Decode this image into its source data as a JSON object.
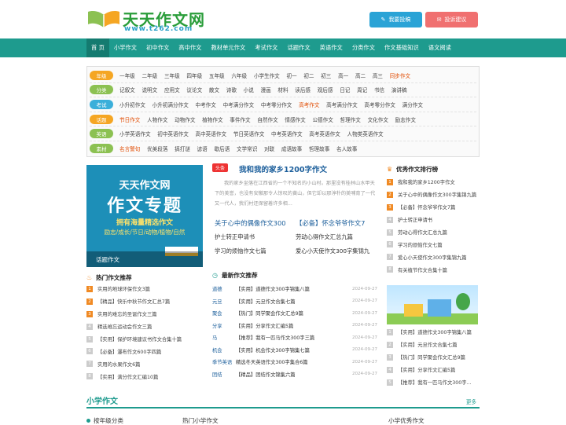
{
  "header": {
    "logo_text": "天天作文网",
    "logo_url": "www.t262.com",
    "submit_label": "我要投稿",
    "suggest_label": "投诉建议"
  },
  "nav": [
    "首 页",
    "小学作文",
    "初中作文",
    "高中作文",
    "教材单元作文",
    "考试作文",
    "话题作文",
    "英语作文",
    "分类作文",
    "作文基础知识",
    "语文阅读"
  ],
  "categories": [
    {
      "tag": "年级",
      "color": "#f5a623",
      "items": [
        "一年级",
        "二年级",
        "三年级",
        "四年级",
        "五年级",
        "六年级",
        "小学生作文",
        "初一",
        "初二",
        "初三",
        "高一",
        "高二",
        "高三"
      ],
      "extra": "同步作文"
    },
    {
      "tag": "分类",
      "color": "#8cc152",
      "items": [
        "记叙文",
        "说明文",
        "应用文",
        "议论文",
        "散文",
        "诗歌",
        "小说",
        "漫画",
        "材料",
        "读后感",
        "观后感",
        "日记",
        "周记",
        "书信",
        "演讲稿"
      ],
      "extra": ""
    },
    {
      "tag": "考试",
      "color": "#3bafda",
      "items": [
        "小升初作文",
        "小升初满分作文",
        "中考作文",
        "中考满分作文",
        "中考零分作文",
        "高考作文",
        "高考满分作文",
        "高考零分作文",
        "满分作文"
      ],
      "extra": ""
    },
    {
      "tag": "话题",
      "color": "#f5a623",
      "items": [
        "节日作文",
        "人物作文",
        "动物作文",
        "植物作文",
        "事件作文",
        "自然作文",
        "情感作文",
        "公德作文",
        "哲理作文",
        "文化作文",
        "励志作文"
      ],
      "extra": ""
    },
    {
      "tag": "英语",
      "color": "#8cc152",
      "items": [
        "小学英语作文",
        "初中英语作文",
        "高中英语作文",
        "节日英语作文",
        "中考英语作文",
        "高考英语作文",
        "人物类英语作文"
      ],
      "extra": ""
    },
    {
      "tag": "素材",
      "color": "#8cc152",
      "items": [
        "名言警句",
        "优美段落",
        "搞打谜",
        "谚语",
        "歇后语",
        "文学常识",
        "对联",
        "成语故事",
        "哲理故事",
        "名人故事"
      ],
      "extra": ""
    }
  ],
  "banner": {
    "line1": "天天作文网",
    "line2": "作文专题",
    "line3": "拥有海量精选作文",
    "line4": "励志/成长/节日/动物/植物/自然",
    "caption": "话题作文"
  },
  "hot": {
    "title": "热门作文推荐",
    "items": [
      "实用的地球环保作文3篇",
      "【精品】快乐中秋节作文汇总7篇",
      "实用的难忘的圣诞作文三篇",
      "精选难忘运动会作文三篇",
      "【实用】保护环境建议书作文合集十篇",
      "【必备】瀑布作文600字四篇",
      "实用的水果作文6篇",
      "【实用】满分作文汇编10篇"
    ]
  },
  "featured": {
    "badge": "头条",
    "title": "我和我的家乡1200字作文",
    "summary": "我的家乡坐落在江西省的一个不知名的小山村。那里没有桂林山水甲天下的美誉，也没有安徽那令人惊叹的黄山，但它却以那淳朴的美哺育了一代又一代人，我们村还保留着许多相…",
    "picks": [
      "关于心中的偶像作文300",
      "【必备】怀念爷爷作文7"
    ],
    "links": [
      "护士转正申请书",
      "劳动心得作文汇总九篇",
      "学习的烦恼作文七篇",
      "爱心小天使作文300字集锦九"
    ]
  },
  "latest": {
    "title": "最新作文推荐",
    "rows": [
      {
        "cat": "道德",
        "title": "【实用】道德作文300字锦集八篇",
        "date": "2024-09-27"
      },
      {
        "cat": "元旦",
        "title": "【实用】元旦作文合集七篇",
        "date": "2024-09-27"
      },
      {
        "cat": "聚会",
        "title": "【热门】同学聚会作文汇总9篇",
        "date": "2024-09-27"
      },
      {
        "cat": "分享",
        "title": "【实用】分享作文汇编5篇",
        "date": "2024-09-27"
      },
      {
        "cat": "马",
        "title": "【推荐】我有一匹马作文300字三篇",
        "date": "2024-09-27"
      },
      {
        "cat": "机会",
        "title": "【实用】机会作文300字锦集七篇",
        "date": "2024-09-27"
      },
      {
        "cat": "季节英语",
        "title": "精选冬天英语作文300字集合6篇",
        "date": "2024-09-27"
      },
      {
        "cat": "团结",
        "title": "【精品】团结作文锦集六篇",
        "date": "2024-09-27"
      }
    ]
  },
  "rank": {
    "title": "优秀作文排行榜",
    "items": [
      "我和我的家乡1200字作文",
      "关于心中的偶像作文300字集锦九篇",
      "【必备】怀念爷爷作文7篇",
      "护士转正申请书",
      "劳动心得作文汇总九篇",
      "学习的烦恼作文七篇",
      "爱心小天使作文300字集锦九篇",
      "有关植节作文合集十篇"
    ],
    "items2": [
      "【实用】道德作文300字锦集八篇",
      "【实用】元旦作文合集七篇",
      "【热门】同学聚会作文汇总9篇",
      "【实用】分享作文汇编5篇",
      "【推荐】我有一匹马作文300字..."
    ]
  },
  "section": {
    "title": "小学作文",
    "more": "更多",
    "sub1": "按年级分类",
    "sub2": "热门小学作文",
    "sub3": "小学优秀作文"
  },
  "colors": {
    "brand": "#1e9b8e",
    "accent": "#f08a24",
    "link": "#1b5e9b"
  }
}
